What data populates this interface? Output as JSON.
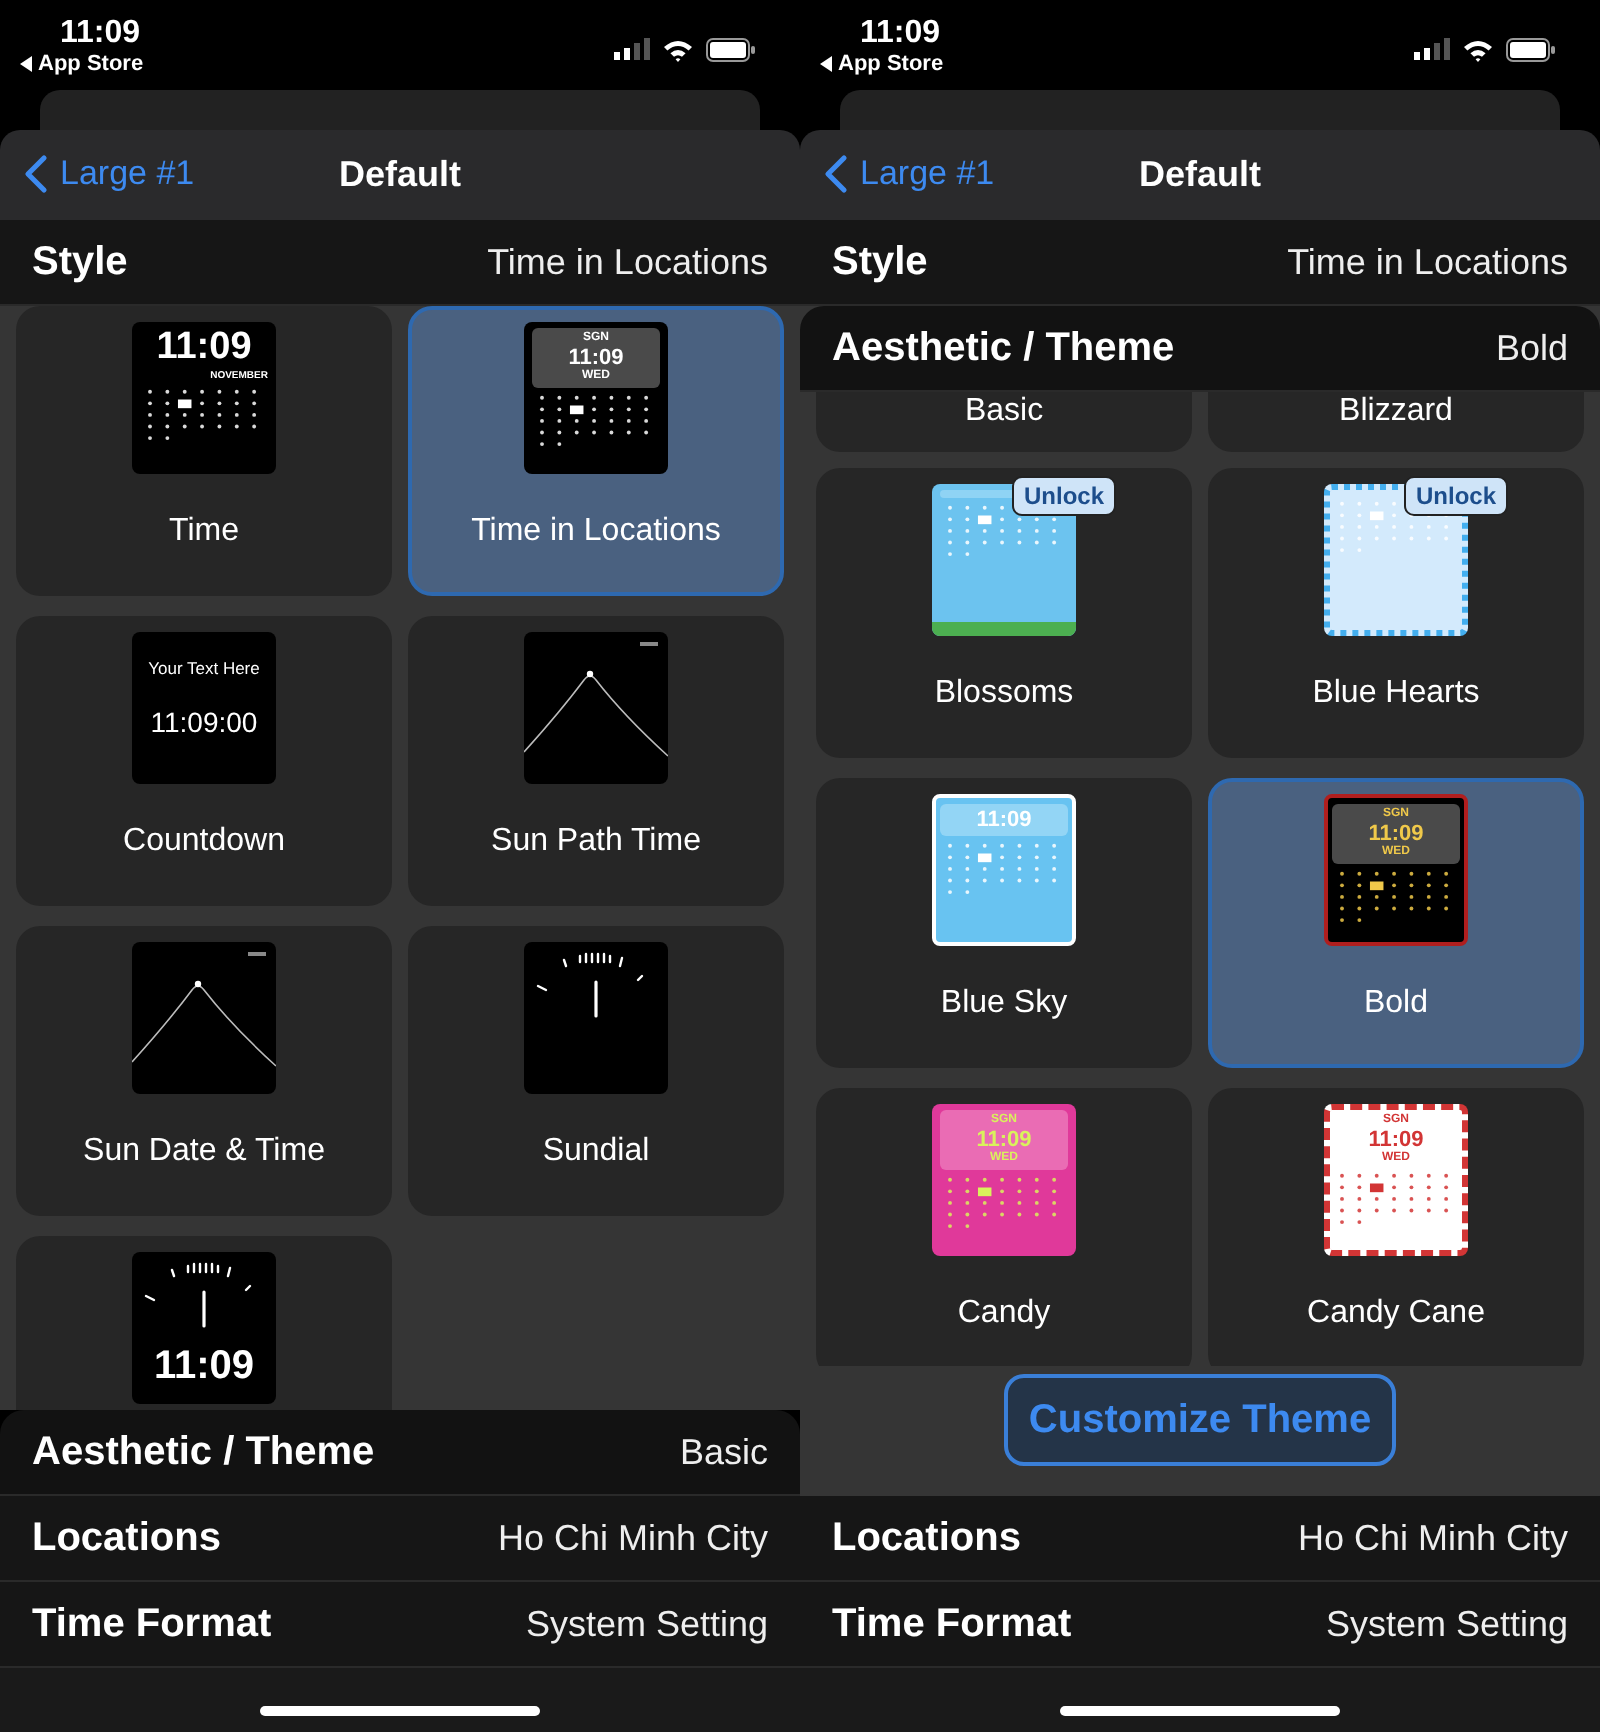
{
  "screens": [
    {
      "status_bar": {
        "time": "11:09",
        "back_label": "App Store"
      },
      "nav": {
        "back": "Large #1",
        "title": "Default"
      },
      "sections": [
        {
          "kind": "row",
          "label": "Style",
          "value": "Time in Locations"
        },
        {
          "kind": "grid",
          "items": [
            {
              "label": "Time",
              "selected": false,
              "thumb": {
                "kind": "time",
                "time": "11:09",
                "month": "NOVEMBER"
              }
            },
            {
              "label": "Time in Locations",
              "selected": true,
              "thumb": {
                "kind": "locations",
                "city": "SGN",
                "time": "11:09",
                "day": "WED"
              }
            },
            {
              "label": "Countdown",
              "selected": false,
              "thumb": {
                "kind": "countdown",
                "caption": "Your Text Here",
                "time": "11:09:00"
              }
            },
            {
              "label": "Sun Path Time",
              "selected": false,
              "thumb": {
                "kind": "sunpath"
              }
            },
            {
              "label": "Sun Date & Time",
              "selected": false,
              "thumb": {
                "kind": "sunpath"
              }
            },
            {
              "label": "Sundial",
              "selected": false,
              "thumb": {
                "kind": "sundial"
              }
            },
            {
              "selected": false,
              "thumb": {
                "kind": "sundial",
                "time": "11:09"
              }
            }
          ]
        },
        {
          "kind": "row",
          "label": "Aesthetic / Theme",
          "value": "Basic",
          "rounded": true
        },
        {
          "kind": "row",
          "label": "Locations",
          "value": "Ho Chi Minh City"
        },
        {
          "kind": "row",
          "label": "Time Format",
          "value": "System Setting"
        }
      ]
    },
    {
      "status_bar": {
        "time": "11:09",
        "back_label": "App Store"
      },
      "nav": {
        "back": "Large #1",
        "title": "Default"
      },
      "sections": [
        {
          "kind": "row",
          "label": "Style",
          "value": "Time in Locations"
        },
        {
          "kind": "grid",
          "header": {
            "label": "Aesthetic / Theme",
            "value": "Bold"
          },
          "partial": [
            "Basic",
            "Blizzard"
          ],
          "items": [
            {
              "label": "Blossoms",
              "selected": false,
              "badge": "Unlock",
              "thumb": {
                "kind": "blossoms"
              }
            },
            {
              "label": "Blue Hearts",
              "selected": false,
              "badge": "Unlock",
              "thumb": {
                "kind": "hearts"
              }
            },
            {
              "label": "Blue Sky",
              "selected": false,
              "thumb": {
                "kind": "sky",
                "time": "11:09"
              }
            },
            {
              "label": "Bold",
              "selected": true,
              "thumb": {
                "kind": "bold",
                "city": "SGN",
                "time": "11:09",
                "day": "WED"
              }
            },
            {
              "label": "Candy",
              "selected": false,
              "thumb": {
                "kind": "candy",
                "city": "SGN",
                "time": "11:09",
                "day": "WED"
              }
            },
            {
              "label": "Candy Cane",
              "selected": false,
              "thumb": {
                "kind": "candycane",
                "city": "SGN",
                "time": "11:09",
                "day": "WED"
              }
            }
          ]
        },
        {
          "kind": "button",
          "label": "Customize Theme"
        },
        {
          "kind": "row",
          "label": "Locations",
          "value": "Ho Chi Minh City"
        },
        {
          "kind": "row",
          "label": "Time Format",
          "value": "System Setting"
        }
      ]
    }
  ]
}
